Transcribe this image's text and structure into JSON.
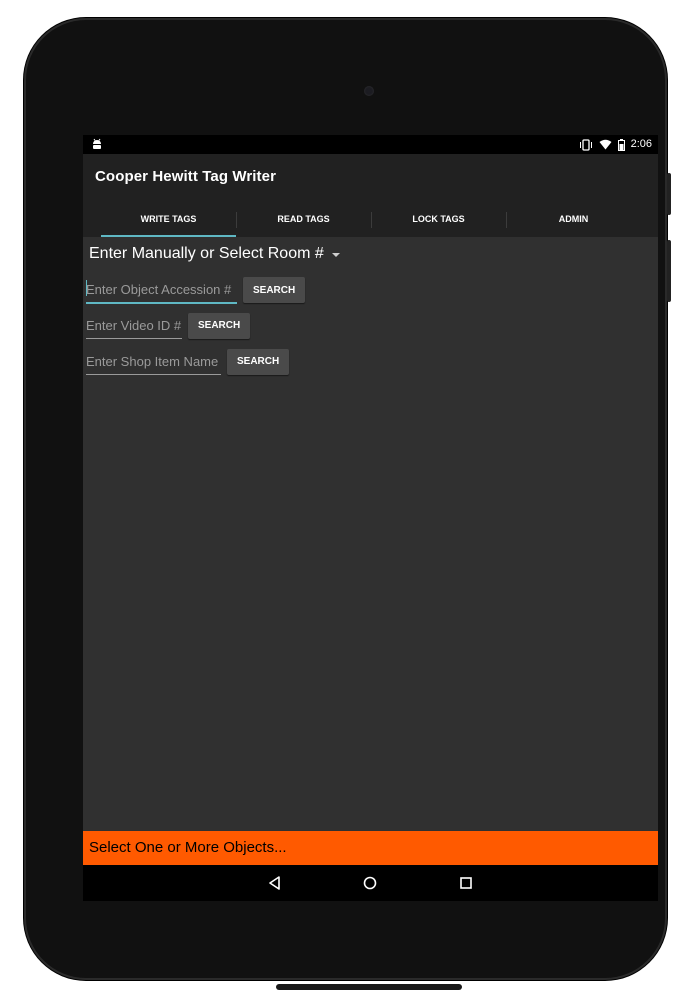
{
  "status_bar": {
    "time": "2:06",
    "icons": [
      "android-debug-icon",
      "vibrate-icon",
      "wifi-icon",
      "battery-icon"
    ]
  },
  "app": {
    "title": "Cooper Hewitt Tag Writer"
  },
  "tabs": [
    {
      "label": "WRITE TAGS",
      "active": true
    },
    {
      "label": "READ TAGS",
      "active": false
    },
    {
      "label": "LOCK TAGS",
      "active": false
    },
    {
      "label": "ADMIN",
      "active": false
    }
  ],
  "room_spinner": {
    "selected": "Enter Manually or Select Room #"
  },
  "search_rows": [
    {
      "placeholder": "Enter Object Accession #",
      "value": "",
      "button": "SEARCH"
    },
    {
      "placeholder": "Enter Video ID #",
      "value": "",
      "button": "SEARCH"
    },
    {
      "placeholder": "Enter Shop Item Name",
      "value": "",
      "button": "SEARCH"
    }
  ],
  "status_message": "Select One or More Objects...",
  "nav": {
    "icons": [
      "back-icon",
      "home-icon",
      "recents-icon"
    ]
  },
  "colors": {
    "accent": "#5fb8c4",
    "status_strip": "#ff5a00",
    "background": "#303030",
    "action_bar": "#212121"
  }
}
